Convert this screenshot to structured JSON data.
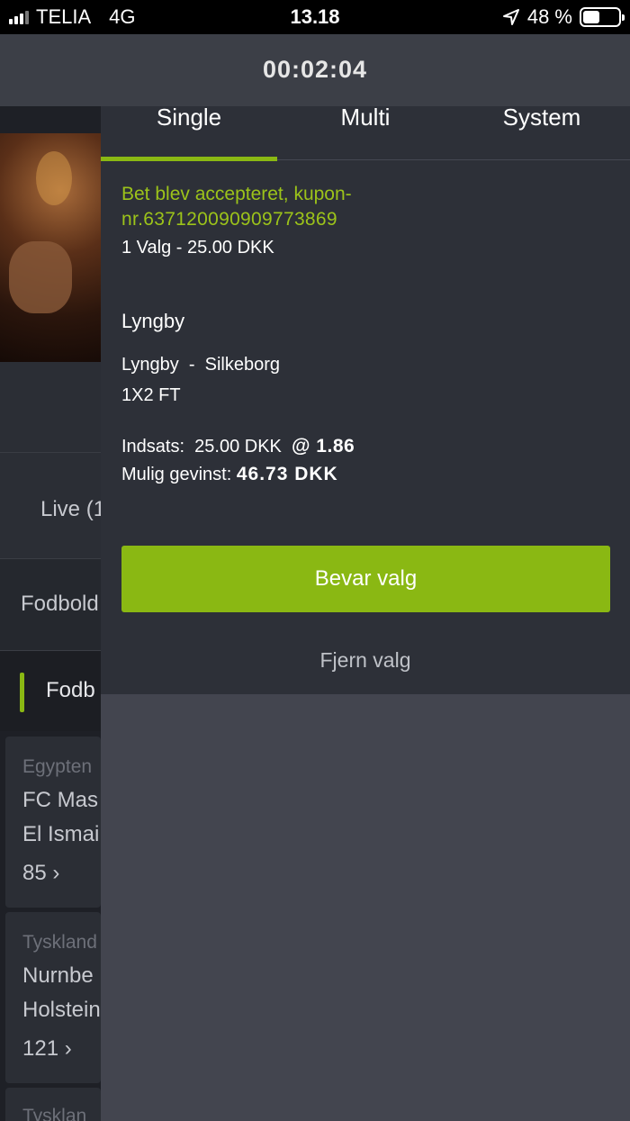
{
  "status_bar": {
    "carrier": "TELIA",
    "network": "4G",
    "time": "13.18",
    "battery": "48 %",
    "battery_level": 0.48,
    "icons": [
      "signal-icon",
      "location-arrow-icon",
      "battery-icon"
    ]
  },
  "timer": "00:02:04",
  "background": {
    "live_label": "Live (1",
    "sport_label": "Fodbold",
    "sub_label": "Fodb",
    "cards": [
      {
        "league": "Egypten",
        "home": "FC Mas",
        "away": "El Ismai",
        "more": "85"
      },
      {
        "league": "Tyskland",
        "home": "Nurnbe",
        "away": "Holstein",
        "more": "121"
      },
      {
        "league": "Tysklan"
      }
    ]
  },
  "betslip": {
    "tabs": [
      {
        "label": "Single",
        "active": true
      },
      {
        "label": "Multi",
        "active": false
      },
      {
        "label": "System",
        "active": false
      }
    ],
    "confirmation_line1": "Bet blev accepteret, kupon-",
    "confirmation_line2": "nr.637120090909773869",
    "summary": "1 Valg - 25.00 DKK",
    "selection": "Lyngby",
    "match": "Lyngby  -  Silkeborg",
    "market": "1X2 FT",
    "stake_label": "Indsats:  25.00 DKK  ",
    "odds": "@ 1.86",
    "winnings_label": "Mulig gevinst: ",
    "winnings_value": "46.73 DKK",
    "keep_button": "Bevar valg",
    "remove_button": "Fjern valg"
  },
  "colors": {
    "accent": "#8ab813",
    "confirm_text": "#9cc31a",
    "panel_bg": "#2d3038",
    "timer_bg": "#3c3f47"
  }
}
